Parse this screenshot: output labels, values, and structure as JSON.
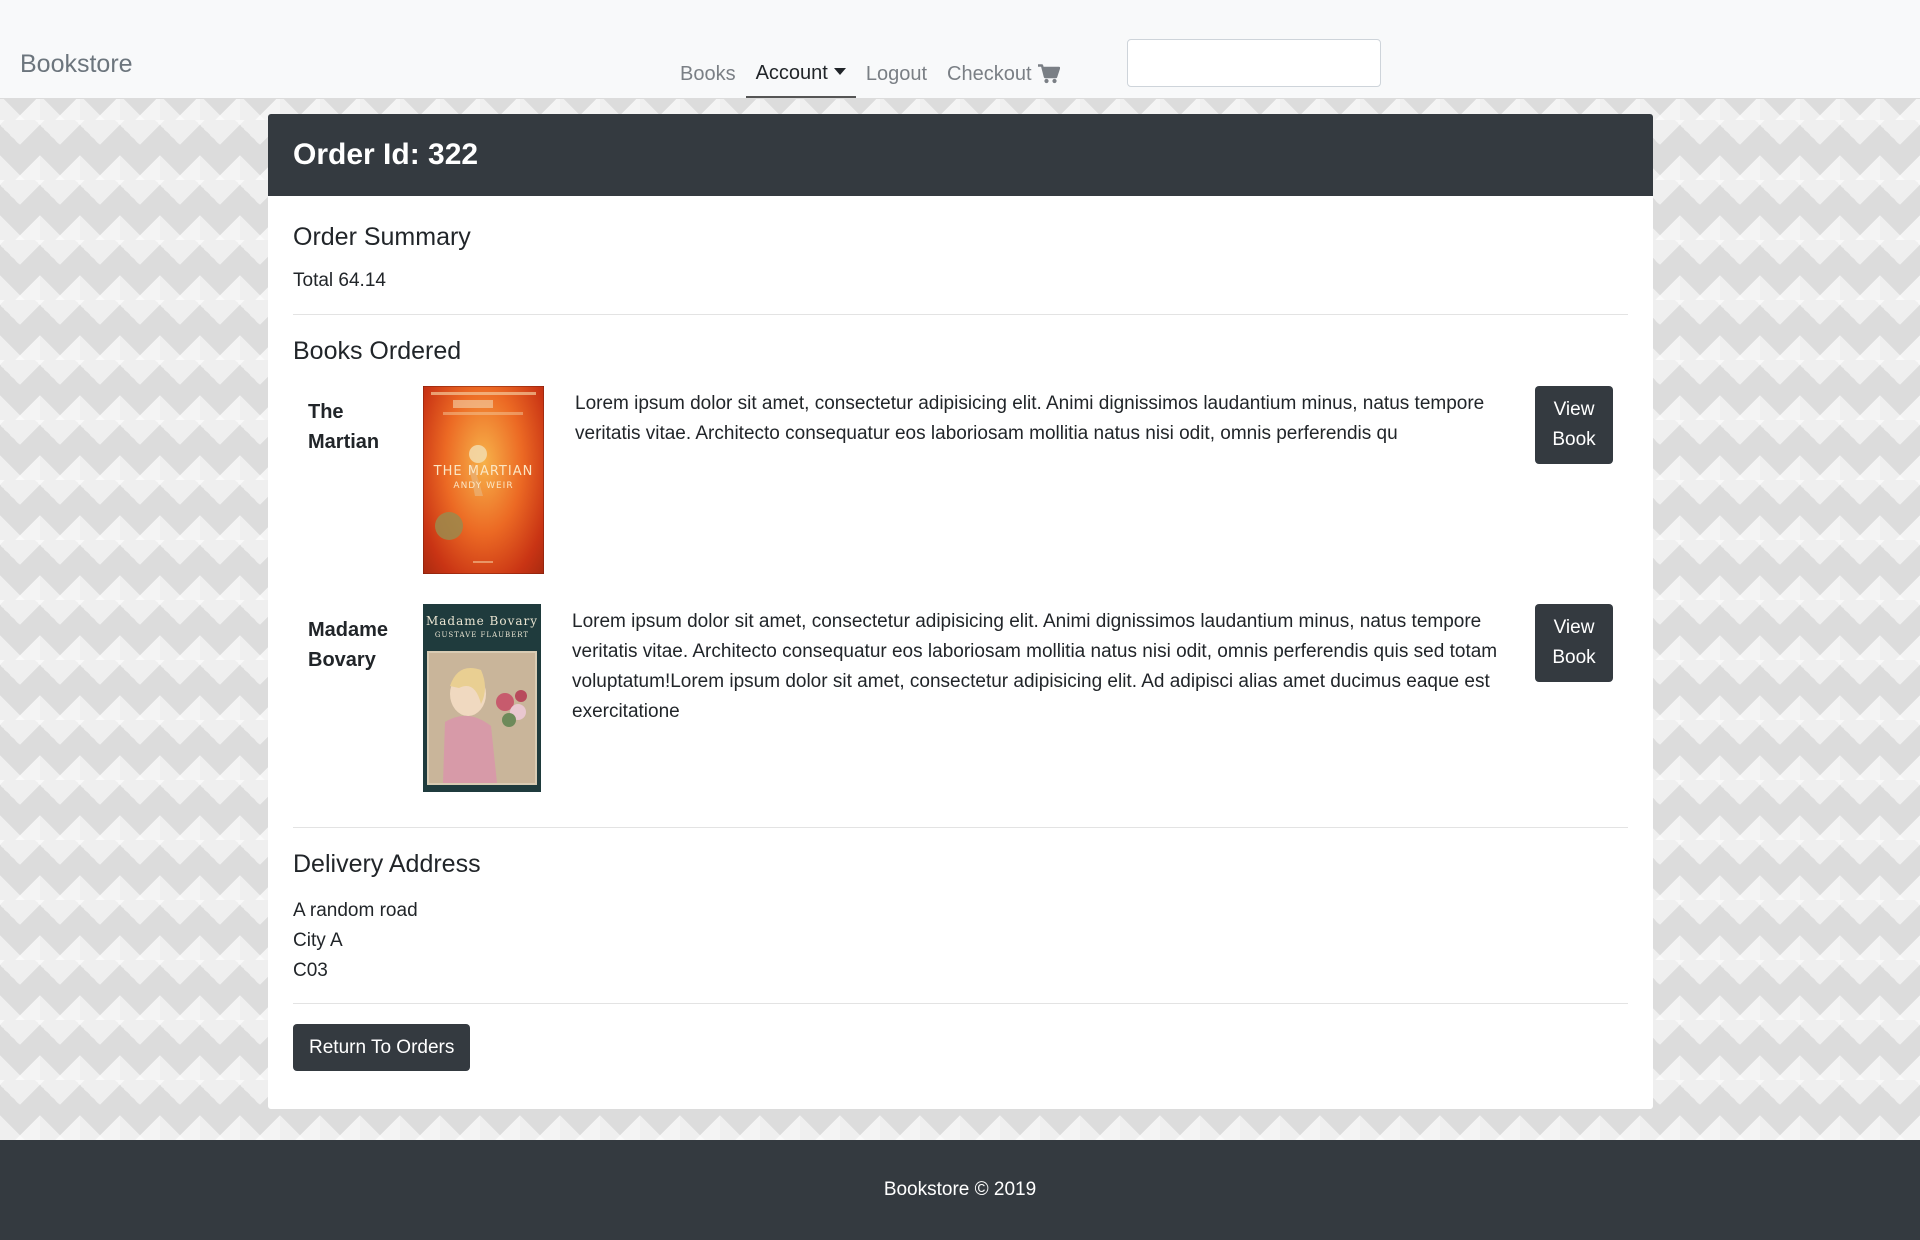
{
  "navbar": {
    "brand": "Bookstore",
    "links": {
      "books": "Books",
      "account": "Account",
      "logout": "Logout",
      "checkout": "Checkout"
    },
    "cart_icon": "shopping-cart-icon",
    "search": {
      "value": "",
      "placeholder": ""
    }
  },
  "order": {
    "header": "Order Id: 322",
    "summary_title": "Order Summary",
    "total_text": "Total 64.14",
    "books_title": "Books Ordered",
    "books": [
      {
        "title_line1": "The",
        "title_line2": "Martian",
        "cover_title": "THE MARTIAN",
        "cover_author": "ANDY WEIR",
        "description": "Lorem ipsum dolor sit amet, consectetur adipisicing elit. Animi dignissimos laudantium minus, natus tempore veritatis vitae. Architecto consequatur eos laboriosam mollitia natus nisi odit, omnis perferendis qu",
        "button": "View Book"
      },
      {
        "title_line1": "Madame",
        "title_line2": "Bovary",
        "cover_title": "Madame Bovary",
        "cover_author": "GUSTAVE FLAUBERT",
        "description": "Lorem ipsum dolor sit amet, consectetur adipisicing elit. Animi dignissimos laudantium minus, natus tempore veritatis vitae. Architecto consequatur eos laboriosam mollitia natus nisi odit, omnis perferendis quis sed totam voluptatum!Lorem ipsum dolor sit amet, consectetur adipisicing elit. Ad adipisci alias amet ducimus eaque est exercitatione",
        "button": "View Book"
      }
    ],
    "address_title": "Delivery Address",
    "address": {
      "line1": "A random road",
      "line2": "City A",
      "line3": "C03"
    },
    "return_button": "Return To Orders"
  },
  "footer": {
    "text": "Bookstore © 2019"
  },
  "colors": {
    "dark": "#343a40",
    "navbar_bg": "#f8f9fa",
    "link_muted": "#7a7f85"
  }
}
